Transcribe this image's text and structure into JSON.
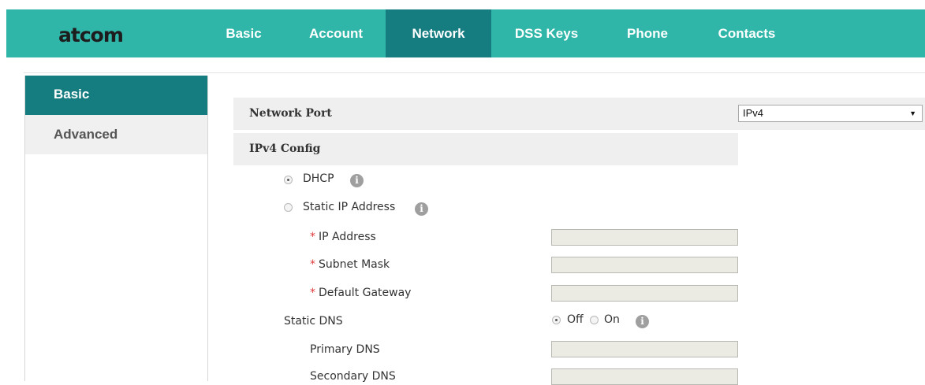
{
  "header": {
    "logo": "atcom",
    "nav": [
      "Basic",
      "Account",
      "Network",
      "DSS Keys",
      "Phone",
      "Contacts"
    ],
    "active_nav": "Network"
  },
  "sidebar": {
    "items": [
      "Basic",
      "Advanced"
    ],
    "active": "Basic"
  },
  "network_port": {
    "label": "Network Port",
    "selected": "IPv4"
  },
  "ipv4": {
    "title": "IPv4 Config",
    "dhcp": "DHCP",
    "static_ip": "Static IP Address",
    "mode": "DHCP",
    "ip_address": {
      "label": "IP Address",
      "value": ""
    },
    "subnet_mask": {
      "label": "Subnet Mask",
      "value": ""
    },
    "default_gateway": {
      "label": "Default Gateway",
      "value": ""
    },
    "required_mark": "*",
    "static_dns": {
      "label": "Static DNS",
      "off": "Off",
      "on": "On",
      "selected": "Off"
    },
    "primary_dns": {
      "label": "Primary DNS",
      "value": ""
    },
    "secondary_dns": {
      "label": "Secondary DNS",
      "value": ""
    }
  },
  "info_glyph": "i",
  "colors": {
    "header_bg": "#2fb6a8",
    "active_bg": "#157c80",
    "section_bg": "#efefef",
    "required": "#e03b3b"
  }
}
